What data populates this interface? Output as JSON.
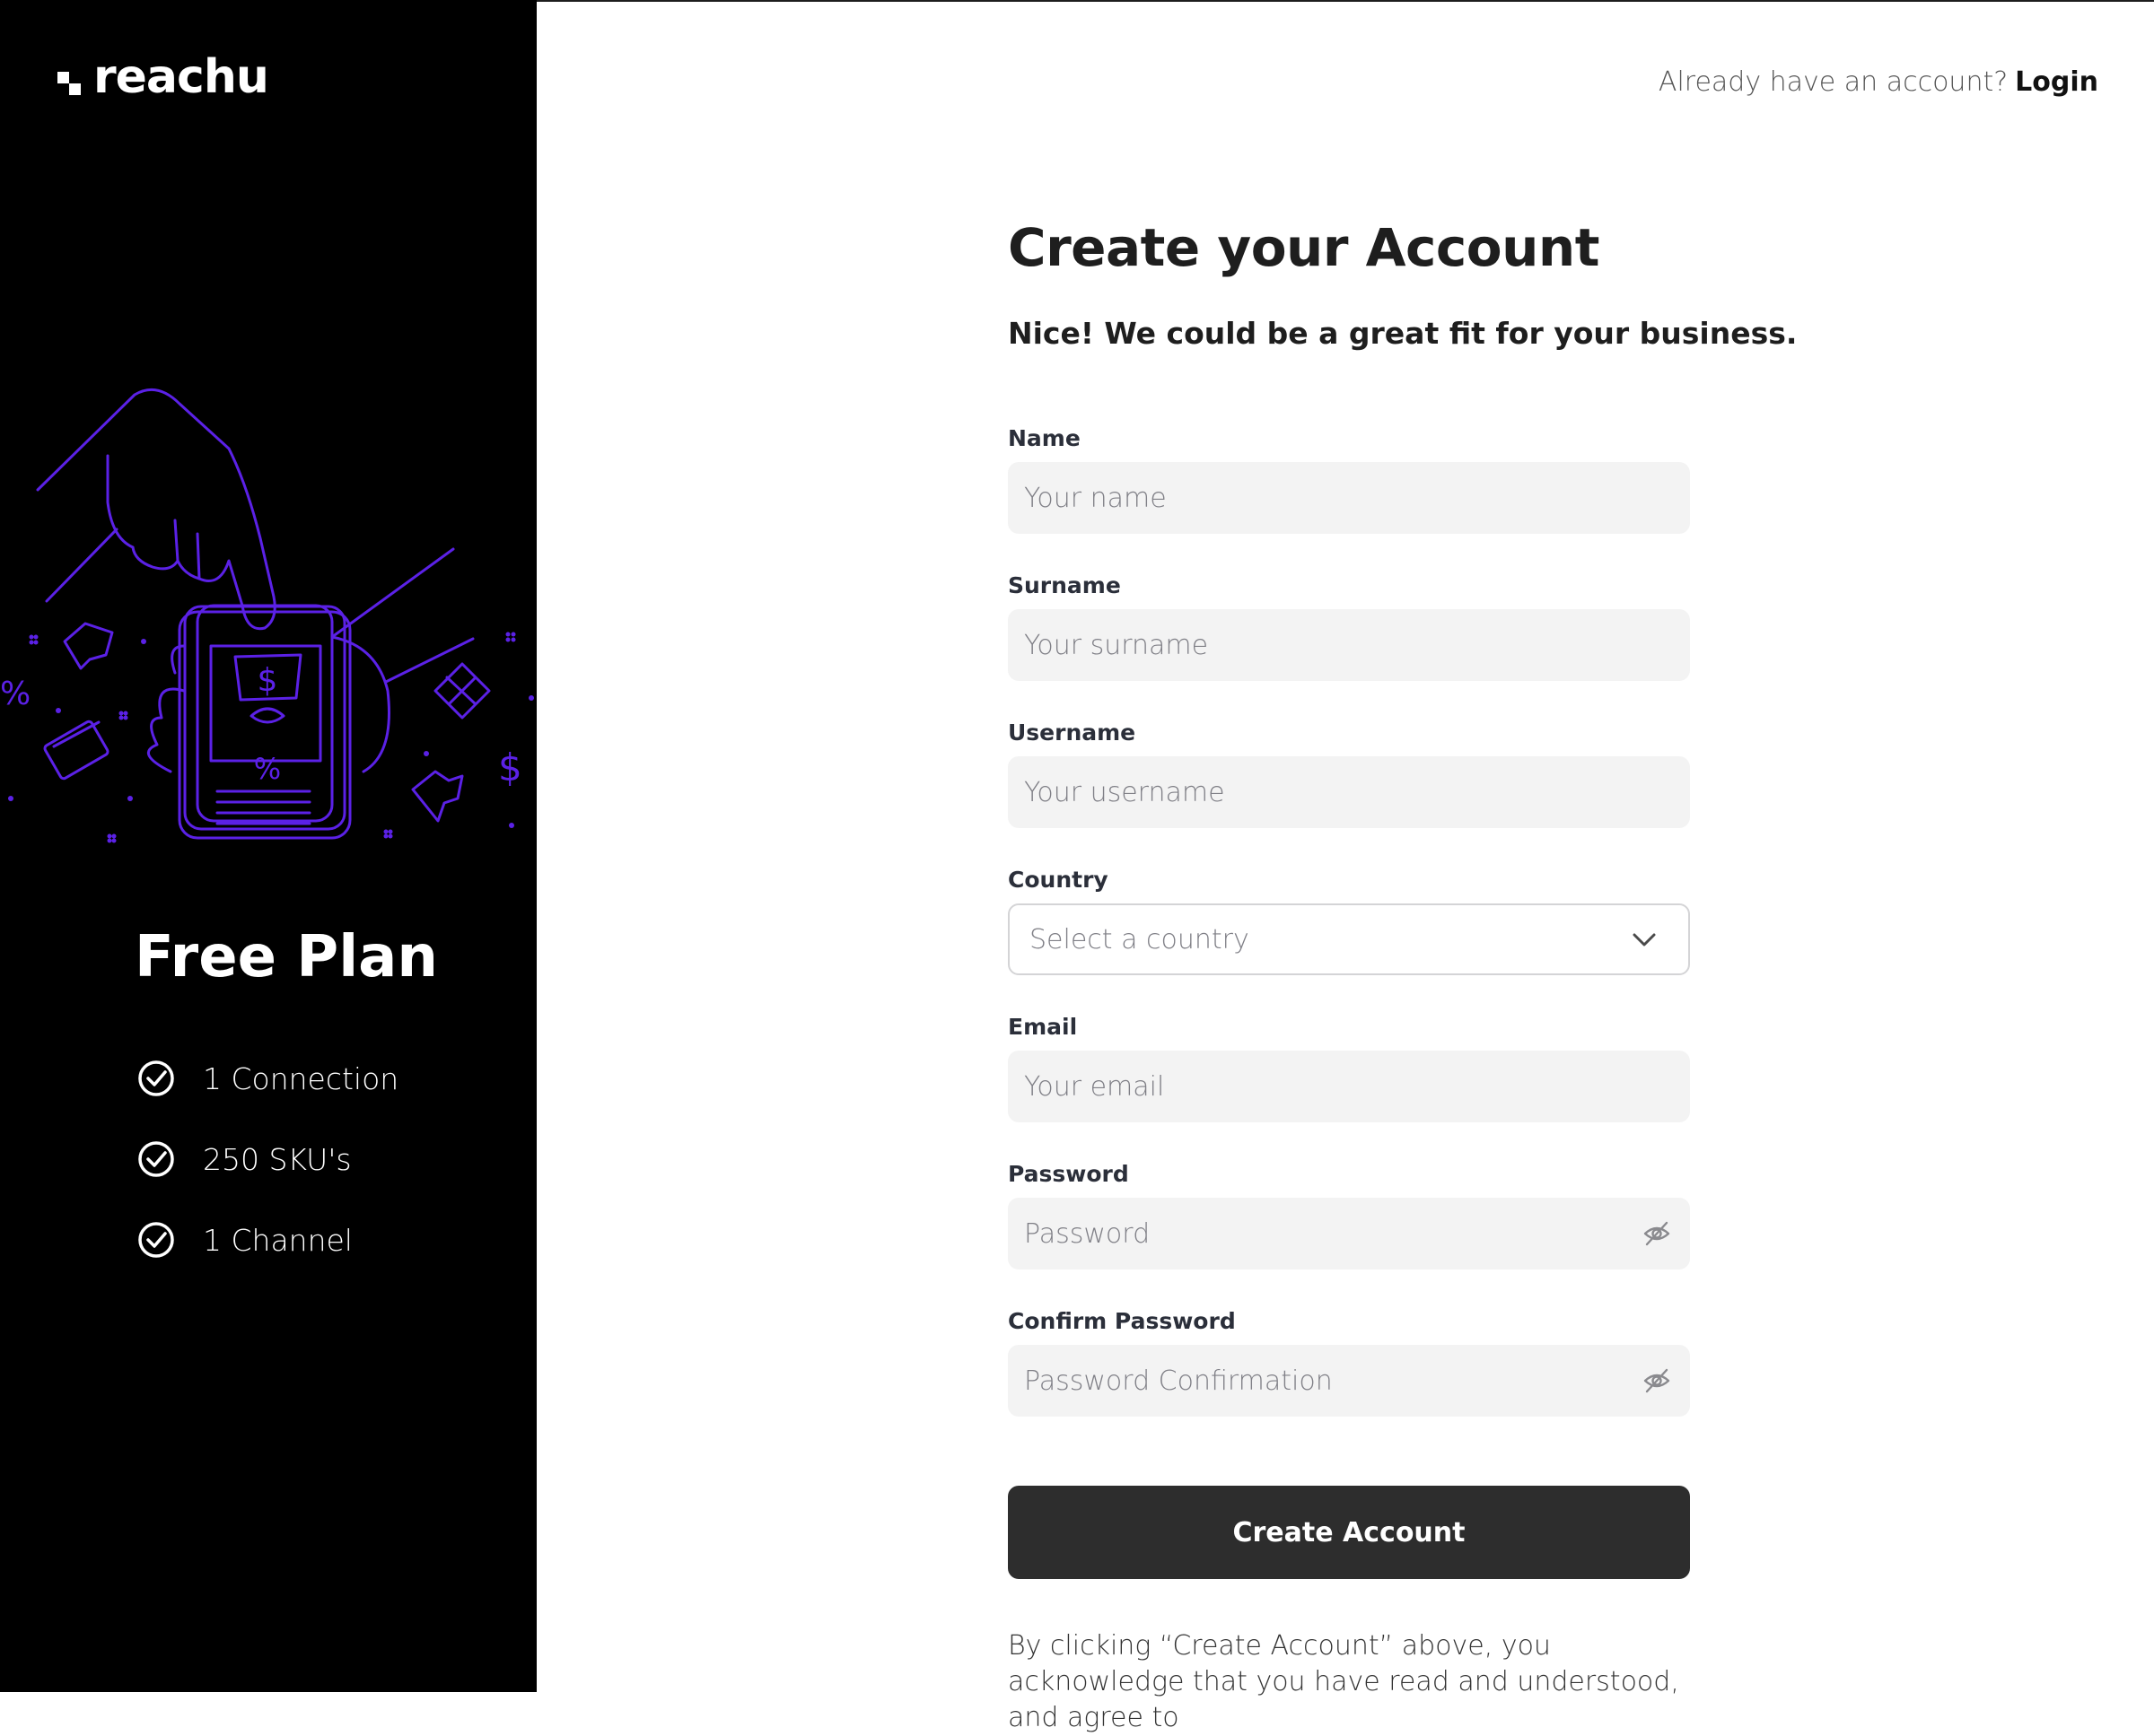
{
  "brand": {
    "name": "reachu"
  },
  "plan": {
    "title": "Free Plan",
    "features": [
      {
        "label": "1 Connection"
      },
      {
        "label": "250 SKU's"
      },
      {
        "label": "1 Channel"
      }
    ]
  },
  "header": {
    "prompt": "Already have an account?",
    "login_label": "Login"
  },
  "form": {
    "title": "Create your Account",
    "subtitle": "Nice! We could be a great fit for your business.",
    "fields": {
      "name": {
        "label": "Name",
        "placeholder": "Your name"
      },
      "surname": {
        "label": "Surname",
        "placeholder": "Your surname"
      },
      "username": {
        "label": "Username",
        "placeholder": "Your username"
      },
      "country": {
        "label": "Country",
        "placeholder": "Select a country"
      },
      "email": {
        "label": "Email",
        "placeholder": "Your email"
      },
      "password": {
        "label": "Password",
        "placeholder": "Password"
      },
      "confirm_password": {
        "label": "Confirm Password",
        "placeholder": "Password Confirmation"
      }
    },
    "submit_label": "Create Account",
    "terms_text": "By clicking “Create Account” above, you acknowledge that you have read and understood, and agree to"
  },
  "icons": {
    "logo": "reachu-logo-mark",
    "check": "check-circle-icon",
    "eye": "eye-off-icon",
    "chevron": "chevron-down-icon"
  },
  "colors": {
    "accent": "#5b21e6",
    "panel": "#000000",
    "button": "#2d2d2d",
    "input_bg": "#f3f3f3"
  }
}
